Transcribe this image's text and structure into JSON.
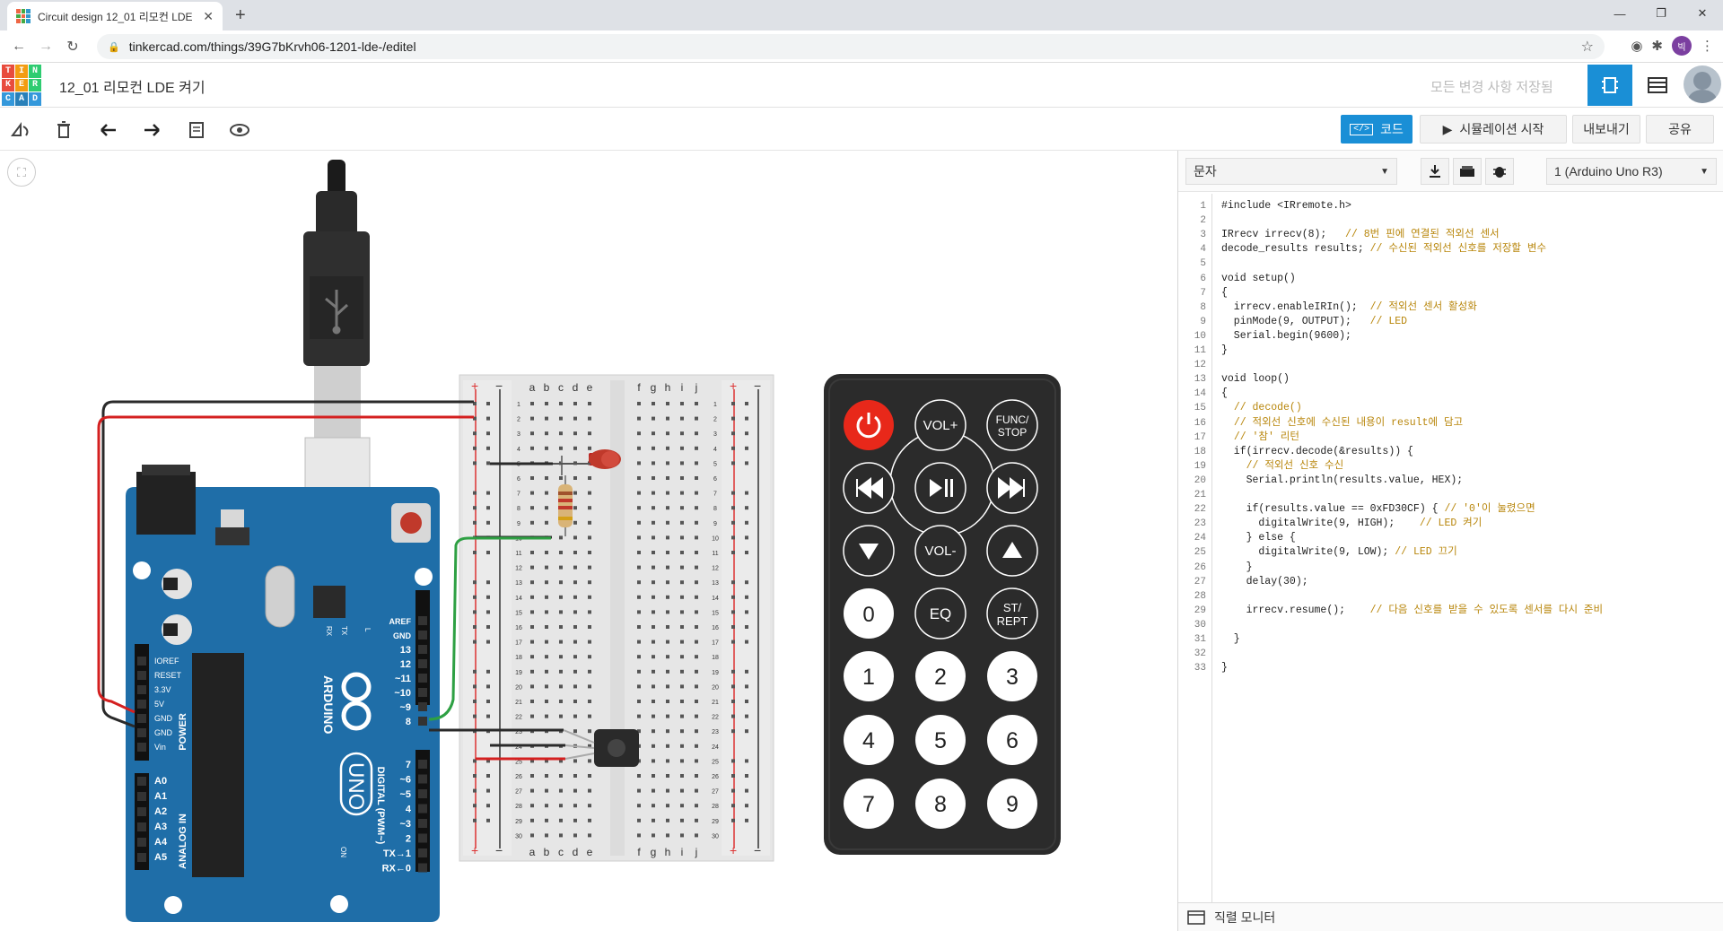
{
  "browser": {
    "tab_title": "Circuit design 12_01 리모컨 LDE",
    "url": "tinkercad.com/things/39G7bKrvh06-1201-lde-/editel",
    "profile_initial": "빅"
  },
  "header": {
    "logo_letters": [
      "T",
      "I",
      "N",
      "K",
      "E",
      "R",
      "C",
      "A",
      "D"
    ],
    "project_title": "12_01 리모컨 LDE 켜기",
    "save_status": "모든 변경 사항 저장됨"
  },
  "toolbar": {
    "code_label": "코드",
    "simulate_label": "시뮬레이션 시작",
    "export_label": "내보내기",
    "share_label": "공유"
  },
  "code_panel": {
    "mode": "문자",
    "device": "1 (Arduino Uno R3)",
    "serial_monitor": "직렬 모니터",
    "lines": [
      {
        "n": "1",
        "code": "#include <IRremote.h>",
        "comment": ""
      },
      {
        "n": "2",
        "code": "",
        "comment": ""
      },
      {
        "n": "3",
        "code": "IRrecv irrecv(8);   ",
        "comment": "// 8번 핀에 연결된 적외선 센서"
      },
      {
        "n": "4",
        "code": "decode_results results; ",
        "comment": "// 수신된 적외선 신호를 저장할 변수"
      },
      {
        "n": "5",
        "code": "",
        "comment": ""
      },
      {
        "n": "6",
        "code": "void setup()",
        "comment": ""
      },
      {
        "n": "7",
        "code": "{",
        "comment": ""
      },
      {
        "n": "8",
        "code": "  irrecv.enableIRIn();  ",
        "comment": "// 적외선 센서 활성화"
      },
      {
        "n": "9",
        "code": "  pinMode(9, OUTPUT);   ",
        "comment": "// LED"
      },
      {
        "n": "10",
        "code": "  Serial.begin(9600);",
        "comment": ""
      },
      {
        "n": "11",
        "code": "}",
        "comment": ""
      },
      {
        "n": "12",
        "code": "",
        "comment": ""
      },
      {
        "n": "13",
        "code": "void loop()",
        "comment": ""
      },
      {
        "n": "14",
        "code": "{",
        "comment": ""
      },
      {
        "n": "15",
        "code": "  ",
        "comment": "// decode()"
      },
      {
        "n": "16",
        "code": "  ",
        "comment": "// 적외선 신호에 수신된 내용이 result에 담고"
      },
      {
        "n": "17",
        "code": "  ",
        "comment": "// '참' 리턴"
      },
      {
        "n": "18",
        "code": "  if(irrecv.decode(&results)) {",
        "comment": ""
      },
      {
        "n": "19",
        "code": "    ",
        "comment": "// 적외선 신호 수신"
      },
      {
        "n": "20",
        "code": "    Serial.println(results.value, HEX);",
        "comment": ""
      },
      {
        "n": "21",
        "code": "",
        "comment": ""
      },
      {
        "n": "22",
        "code": "    if(results.value == 0xFD30CF) { ",
        "comment": "// '0'이 눌렸으면"
      },
      {
        "n": "23",
        "code": "      digitalWrite(9, HIGH);    ",
        "comment": "// LED 켜기"
      },
      {
        "n": "24",
        "code": "    } else {",
        "comment": ""
      },
      {
        "n": "25",
        "code": "      digitalWrite(9, LOW); ",
        "comment": "// LED 끄기"
      },
      {
        "n": "26",
        "code": "    }",
        "comment": ""
      },
      {
        "n": "27",
        "code": "    delay(30);",
        "comment": ""
      },
      {
        "n": "28",
        "code": "",
        "comment": ""
      },
      {
        "n": "29",
        "code": "    irrecv.resume();    ",
        "comment": "// 다음 신호를 받을 수 있도록 센서를 다시 준비"
      },
      {
        "n": "30",
        "code": "",
        "comment": ""
      },
      {
        "n": "31",
        "code": "  }",
        "comment": ""
      },
      {
        "n": "32",
        "code": "",
        "comment": ""
      },
      {
        "n": "33",
        "code": "}",
        "comment": ""
      }
    ]
  },
  "breadboard": {
    "left_cols": [
      "a",
      "b",
      "c",
      "d",
      "e"
    ],
    "right_cols": [
      "f",
      "g",
      "h",
      "i",
      "j"
    ],
    "rows": 30
  },
  "arduino": {
    "brand": "ARDUINO",
    "model": "UNO",
    "power_pins": [
      "IOREF",
      "RESET",
      "3.3V",
      "5V",
      "GND",
      "GND",
      "Vin"
    ],
    "analog_pins": [
      "A0",
      "A1",
      "A2",
      "A3",
      "A4",
      "A5"
    ],
    "digital_pins": [
      "AREF",
      "GND",
      "13",
      "12",
      "~11",
      "~10",
      "~9",
      "8",
      "7",
      "~6",
      "~5",
      "4",
      "~3",
      "2",
      "TX→1",
      "RX←0"
    ],
    "power_label": "POWER",
    "analog_label": "ANALOG IN",
    "digital_label": "DIGITAL (PWM~)",
    "rx": "RX",
    "tx": "TX",
    "l": "L",
    "on": "ON"
  },
  "remote": {
    "buttons": [
      "VOL+",
      "FUNC/ STOP",
      "VOL-",
      "0",
      "EQ",
      "ST/ REPT",
      "1",
      "2",
      "3",
      "4",
      "5",
      "6",
      "7",
      "8",
      "9"
    ]
  },
  "colors": {
    "accent": "#1a8fd6",
    "board": "#1f6ea8",
    "remote": "#2b2b2b",
    "power_button": "#e8281a",
    "wire_red": "#d42020",
    "wire_black": "#2a2a2a",
    "wire_green": "#2ea043"
  }
}
